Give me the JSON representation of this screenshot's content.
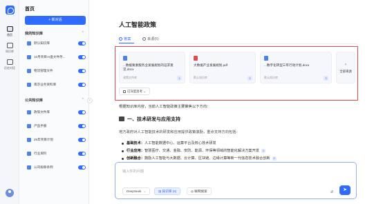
{
  "rail": {
    "items": [
      {
        "label": "首页"
      },
      {
        "label": "知识库"
      },
      {
        "label": "历史对话"
      }
    ]
  },
  "sidebar": {
    "title": "首页",
    "new_button": "+ 新对话",
    "my_kb": {
      "label": "我的知识库",
      "items": [
        {
          "label": "默认知识库"
        },
        {
          "label": "10月项目AI盘文件存..."
        },
        {
          "label": "物流管理文件"
        },
        {
          "label": "南京业务资料库"
        }
      ]
    },
    "public_kb": {
      "label": "公共知识库",
      "items": [
        {
          "label": "政策文件库"
        },
        {
          "label": "产品手册"
        },
        {
          "label": "25年项目计划"
        },
        {
          "label": "行业资料"
        },
        {
          "label": "公司规章条例"
        }
      ]
    }
  },
  "main": {
    "title": "人工智能政策",
    "tabs": [
      {
        "label": "答案"
      },
      {
        "label": "来源(6)"
      }
    ],
    "sources": {
      "cards": [
        {
          "name": "...数据要素服务业发展规划的征求意见.docx",
          "meta": "政策文件库",
          "num": "1",
          "color": "#4a82ea"
        },
        {
          "name": "大数据产业发展规划.pdf",
          "meta": "默认知识库",
          "num": "2",
          "color": "#e5484d"
        },
        {
          "name": "...数字化转型三年行动计划.docx",
          "meta": "默认知识库",
          "num": "3",
          "color": "#4a82ea"
        }
      ],
      "more_label": "全部来源",
      "collapse_label": "已深度思考"
    },
    "intro": "根据知识库内容，当前人工智能政策主要聚焦以下方向：",
    "section_heading": "一、技术研发与应用支持",
    "section_para": "地方政府对人工智能技术的研发和应用提供政策激励，重点支持方向包括：",
    "bullets": [
      {
        "bold": "基础技术：",
        "text": "人工智能数据中心、运算平台及核心技术研发",
        "cite": ""
      },
      {
        "bold": "行业应用：",
        "text": "智慧医疗、交通、金融、安防、能源、环保等领域的智能化解决方案开发",
        "cite": "1"
      },
      {
        "bold": "创新融合：",
        "text": "鼓励人工智能与大数据、云计算、区块链、边缘计算等新一代信息技术融合创新",
        "cite": "2"
      }
    ]
  },
  "composer": {
    "placeholder": "输入你的问题",
    "model": "DeepSeek",
    "kb_chip": "知识库 (6)",
    "web_chip": "联网搜索"
  }
}
